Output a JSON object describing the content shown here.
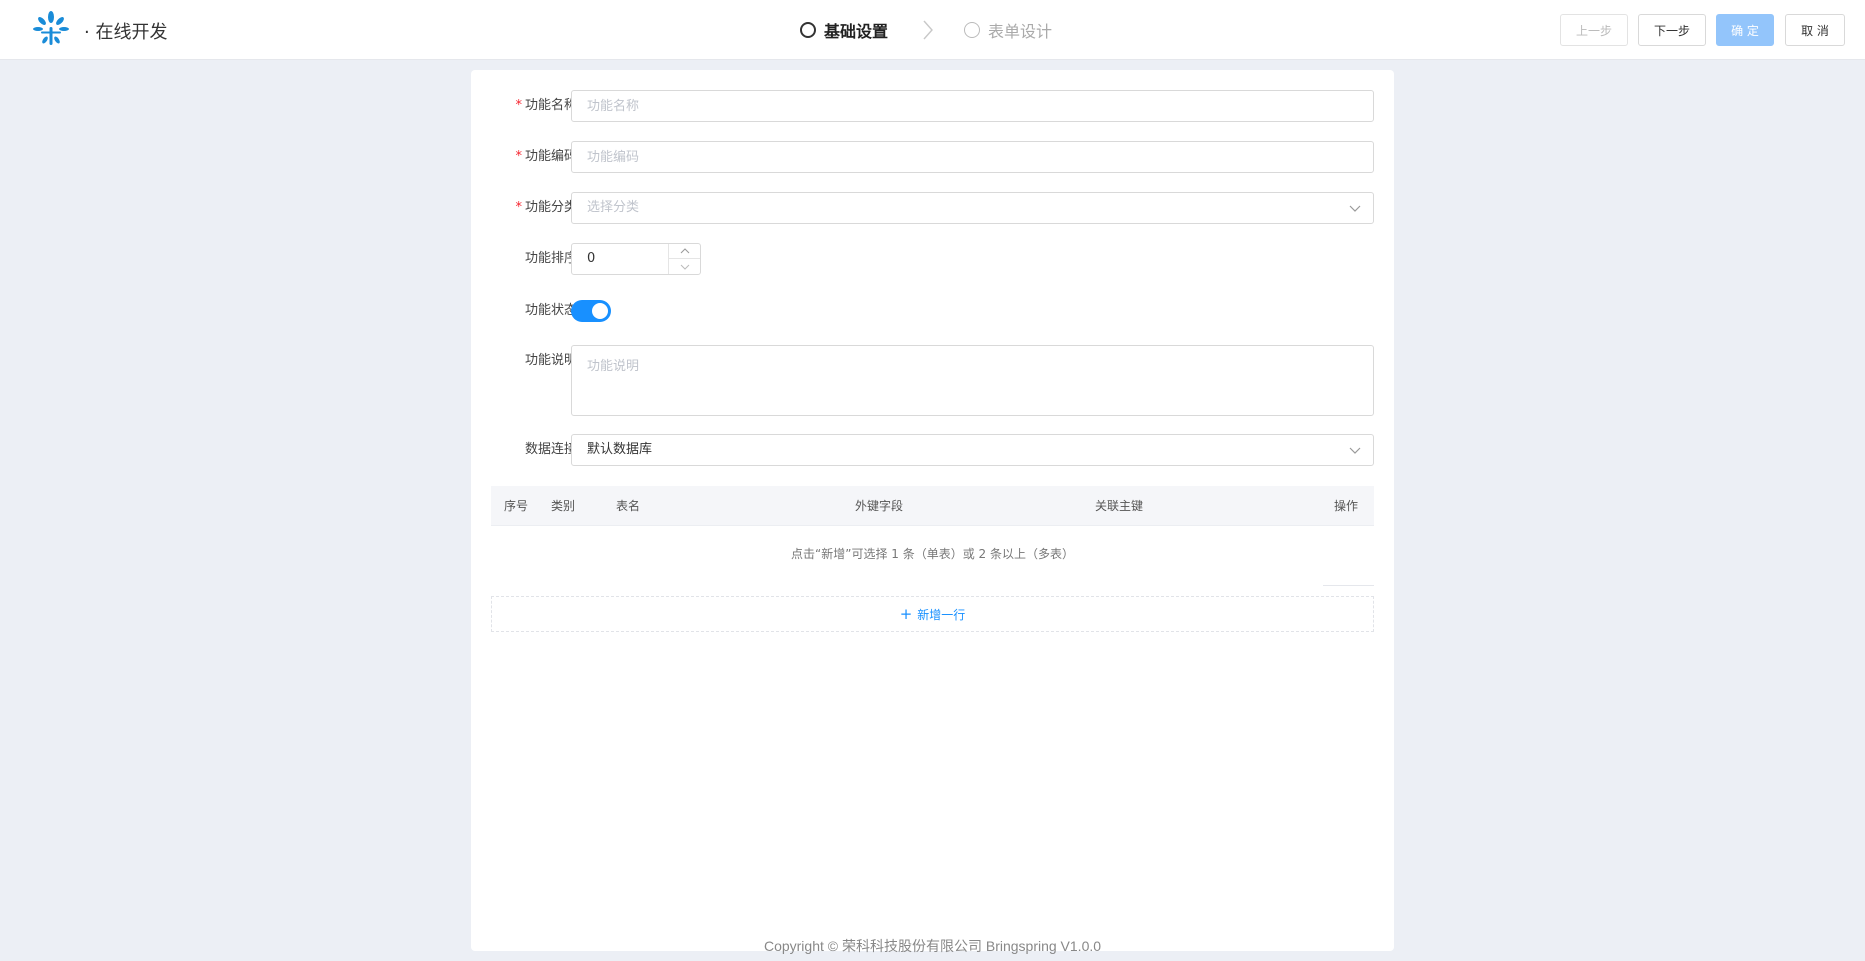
{
  "header": {
    "app_title": "· 在线开发",
    "steps": [
      {
        "label": "基础设置",
        "state": "active"
      },
      {
        "label": "表单设计",
        "state": "inactive"
      }
    ],
    "buttons": {
      "prev": "上一步",
      "next": "下一步",
      "confirm": "确 定",
      "cancel": "取 消"
    }
  },
  "form": {
    "name": {
      "label": "功能名称",
      "required": true,
      "placeholder": "功能名称",
      "value": ""
    },
    "code": {
      "label": "功能编码",
      "required": true,
      "placeholder": "功能编码",
      "value": ""
    },
    "category": {
      "label": "功能分类",
      "required": true,
      "placeholder": "选择分类"
    },
    "sort": {
      "label": "功能排序",
      "value": "0"
    },
    "status": {
      "label": "功能状态",
      "enabled": true
    },
    "description": {
      "label": "功能说明",
      "placeholder": "功能说明",
      "value": ""
    },
    "connection": {
      "label": "数据连接",
      "value": "默认数据库"
    }
  },
  "table": {
    "columns": [
      "序号",
      "类别",
      "表名",
      "外键字段",
      "关联主键",
      "操作"
    ],
    "empty_tip": "点击“新增”可选择 1 条（单表）或 2 条以上（多表）",
    "add_row": "新增一行"
  },
  "footer": {
    "copyright": "Copyright © 荣科科技股份有限公司 Bringspring V1.0.0"
  },
  "colors": {
    "primary": "#1890ff",
    "primary_disabled": "#93c5fb",
    "required": "#f5222d",
    "background": "#eceff5"
  }
}
